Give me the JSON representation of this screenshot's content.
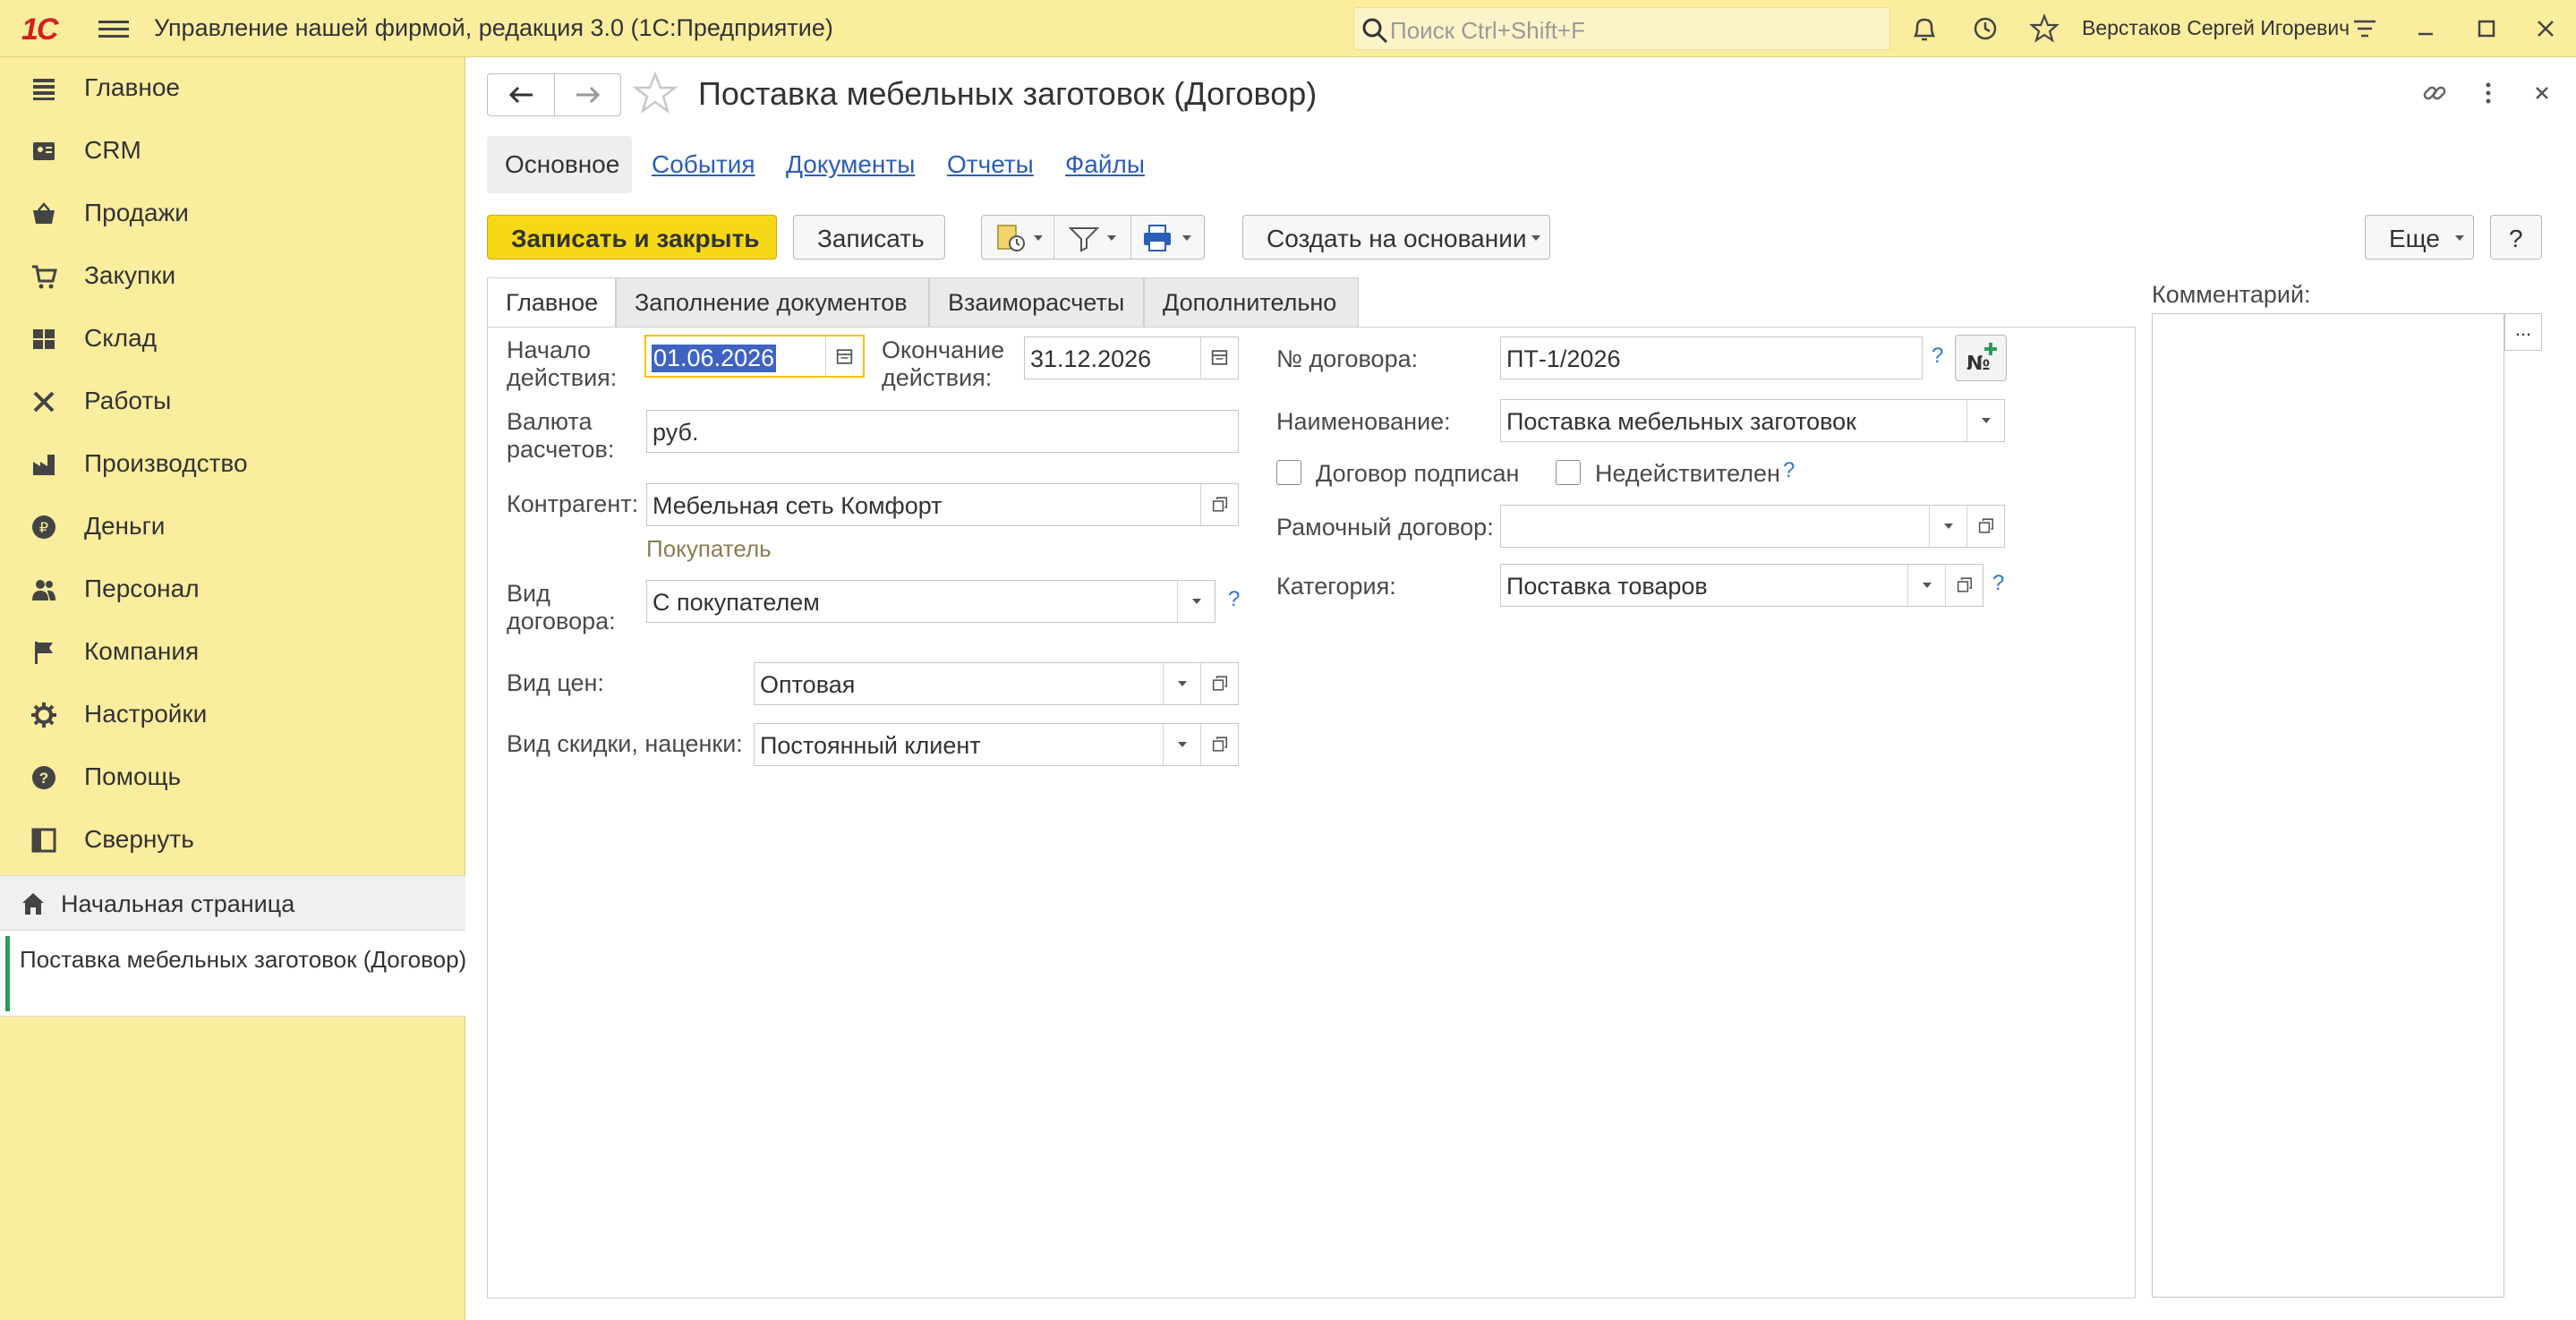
{
  "app": {
    "logo_text": "1С",
    "title": "Управление нашей фирмой, редакция 3.0  (1С:Предприятие)",
    "search_placeholder": "Поиск Ctrl+Shift+F",
    "user": "Верстаков Сергей Игоревич"
  },
  "sidebar": {
    "items": [
      {
        "label": "Главное",
        "icon": "list-icon"
      },
      {
        "label": "CRM",
        "icon": "contacts-icon"
      },
      {
        "label": "Продажи",
        "icon": "basket-icon"
      },
      {
        "label": "Закупки",
        "icon": "cart-icon"
      },
      {
        "label": "Склад",
        "icon": "warehouse-icon"
      },
      {
        "label": "Работы",
        "icon": "tools-icon"
      },
      {
        "label": "Производство",
        "icon": "factory-icon"
      },
      {
        "label": "Деньги",
        "icon": "ruble-icon"
      },
      {
        "label": "Персонал",
        "icon": "people-icon"
      },
      {
        "label": "Компания",
        "icon": "flag-icon"
      },
      {
        "label": "Настройки",
        "icon": "gear-icon"
      },
      {
        "label": "Помощь",
        "icon": "help-icon"
      },
      {
        "label": "Свернуть",
        "icon": "collapse-icon"
      }
    ],
    "home": "Начальная страница",
    "open_document": "Поставка мебельных заготовок (Договор)"
  },
  "document": {
    "title": "Поставка мебельных заготовок (Договор)",
    "nav": {
      "active": "Основное",
      "links": [
        "События",
        "Документы",
        "Отчеты",
        "Файлы"
      ]
    },
    "toolbar": {
      "save_close": "Записать и закрыть",
      "save": "Записать",
      "create_based_on": "Создать на основании",
      "more": "Еще",
      "help": "?"
    },
    "tabs": [
      "Главное",
      "Заполнение документов",
      "Взаиморасчеты",
      "Дополнительно"
    ],
    "form": {
      "start_label": "Начало\nдействия:",
      "start_value": "01.06.2026",
      "end_label": "Окончание\nдействия:",
      "end_value": "31.12.2026",
      "currency_label": "Валюта\nрасчетов:",
      "currency_value": "руб.",
      "counterparty_label": "Контрагент:",
      "counterparty_value": "Мебельная сеть Комфорт",
      "counterparty_role": "Покупатель",
      "contract_type_label": "Вид\nдоговора:",
      "contract_type_value": "С покупателем",
      "price_type_label": "Вид цен:",
      "price_type_value": "Оптовая",
      "discount_label": "Вид скидки, наценки:",
      "discount_value": "Постоянный клиент",
      "number_label": "№ договора:",
      "number_value": "ПТ-1/2026",
      "name_label": "Наименование:",
      "name_value": "Поставка мебельных заготовок",
      "signed_label": "Договор подписан",
      "invalid_label": "Недействителен",
      "framework_label": "Рамочный договор:",
      "framework_value": "",
      "category_label": "Категория:",
      "category_value": "Поставка товаров",
      "help_mark": "?"
    },
    "comment_label": "Комментарий:",
    "comment_button": "..."
  },
  "colors": {
    "panel_yellow": "#fbed9e",
    "primary_button": "#f5d817",
    "link_blue": "#2b5fb7",
    "brand_red": "#d2201e"
  }
}
